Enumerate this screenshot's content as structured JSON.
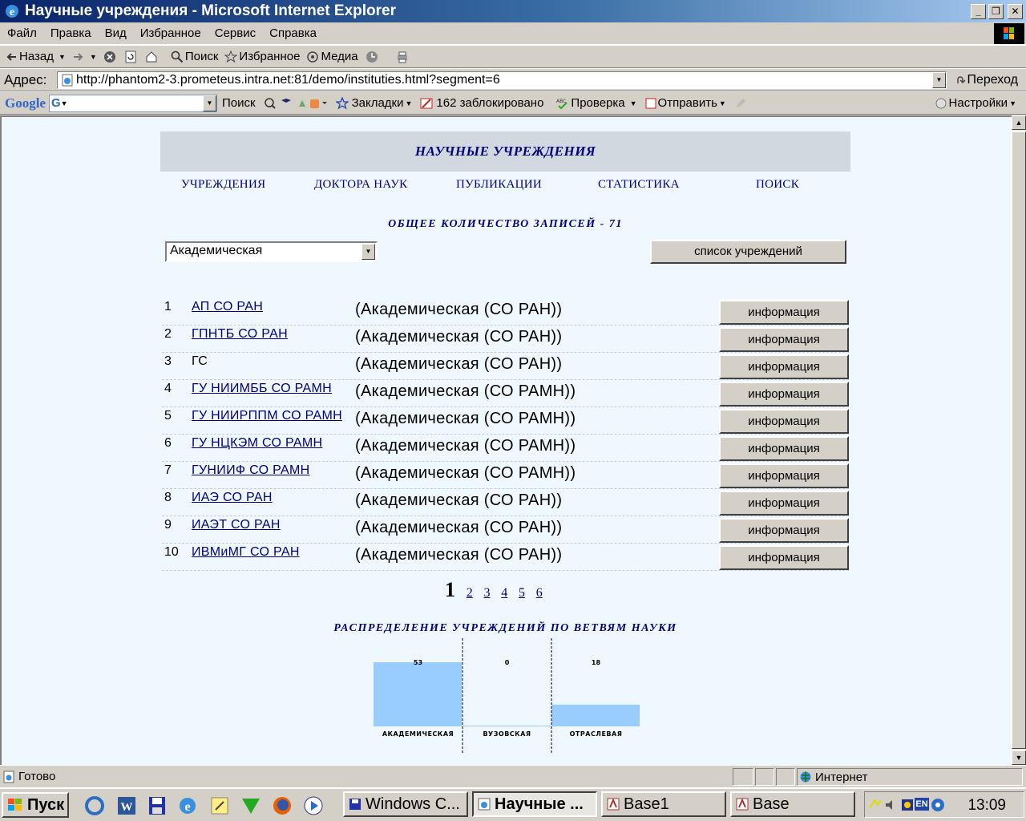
{
  "window": {
    "title": "Научные учреждения - Microsoft Internet Explorer"
  },
  "menu": [
    "Файл",
    "Правка",
    "Вид",
    "Избранное",
    "Сервис",
    "Справка"
  ],
  "toolbar": {
    "back": "Назад",
    "search": "Поиск",
    "favorites": "Избранное",
    "media": "Медиа"
  },
  "address": {
    "label": "Адрес:",
    "url": "http://phantom2-3.prometeus.intra.net:81/demo/instituties.html?segment=6",
    "go": "Переход"
  },
  "google": {
    "logo": "Google",
    "search": "Поиск",
    "bookmarks": "Закладки",
    "blocked": "162 заблокировано",
    "check": "Проверка",
    "send": "Отправить",
    "settings": "Настройки"
  },
  "page": {
    "title": "НАУЧНЫЕ УЧРЕЖДЕНИЯ",
    "nav": [
      "УЧРЕЖДЕНИЯ",
      "ДОКТОРА НАУК",
      "ПУБЛИКАЦИИ",
      "СТАТИСТИКА",
      "ПОИСК"
    ],
    "total": "ОБЩЕЕ КОЛИЧЕСТВО ЗАПИСЕЙ - 71",
    "select_value": "Академическая",
    "list_button": "список учреждений",
    "info_label": "информация",
    "rows": [
      {
        "num": "1",
        "abbr": "АП СО РАН",
        "type": "(Академическая (СО РАН))",
        "link": true
      },
      {
        "num": "2",
        "abbr": "ГПНТБ СО РАН",
        "type": "(Академическая (СО РАН))",
        "link": true
      },
      {
        "num": "3",
        "abbr": "ГС",
        "type": "(Академическая (СО РАН))",
        "link": false
      },
      {
        "num": "4",
        "abbr": "ГУ НИИМББ СО РАМН",
        "type": "(Академическая (СО РАМН))",
        "link": true
      },
      {
        "num": "5",
        "abbr": "ГУ НИИРППМ СО РАМН",
        "type": "(Академическая (СО РАМН))",
        "link": true
      },
      {
        "num": "6",
        "abbr": "ГУ НЦКЭМ СО РАМН",
        "type": "(Академическая (СО РАМН))",
        "link": true
      },
      {
        "num": "7",
        "abbr": "ГУНИИФ СО РАМН",
        "type": "(Академическая (СО РАМН))",
        "link": true
      },
      {
        "num": "8",
        "abbr": "ИАЭ СО РАН",
        "type": "(Академическая (СО РАН))",
        "link": true
      },
      {
        "num": "9",
        "abbr": "ИАЭТ СО РАН",
        "type": "(Академическая (СО РАН))",
        "link": true
      },
      {
        "num": "10",
        "abbr": "ИВМиМГ СО РАН",
        "type": "(Академическая (СО РАН))",
        "link": true
      }
    ],
    "pager": {
      "current": "1",
      "pages": [
        "2",
        "3",
        "4",
        "5",
        "6"
      ]
    },
    "chart_title": "РАСПРЕДЕЛЕНИЕ УЧРЕЖДЕНИЙ ПО ВЕТВЯМ НАУКИ"
  },
  "chart_data": {
    "type": "bar",
    "title": "РАСПРЕДЕЛЕНИЕ УЧРЕЖДЕНИЙ ПО ВЕТВЯМ НАУКИ",
    "categories": [
      "АКАДЕМИЧЕСКАЯ",
      "ВУЗОВСКАЯ",
      "ОТРАСЛЕВАЯ"
    ],
    "values": [
      53,
      0,
      18
    ],
    "ylim": [
      0,
      53
    ],
    "xlabel": "",
    "ylabel": "",
    "grid": false,
    "color": "#99ccff"
  },
  "status": {
    "text": "Готово",
    "zone": "Интернет"
  },
  "taskbar": {
    "start": "Пуск",
    "tasks": [
      "Windows C...",
      "Научные ...",
      "Base1",
      "Base"
    ],
    "clock": "13:09",
    "lang": "EN"
  },
  "colors": {
    "link": "#00007a",
    "page_bg": "#f0f8ff",
    "header_bg": "#d2d8df",
    "bar": "#99ccff"
  }
}
